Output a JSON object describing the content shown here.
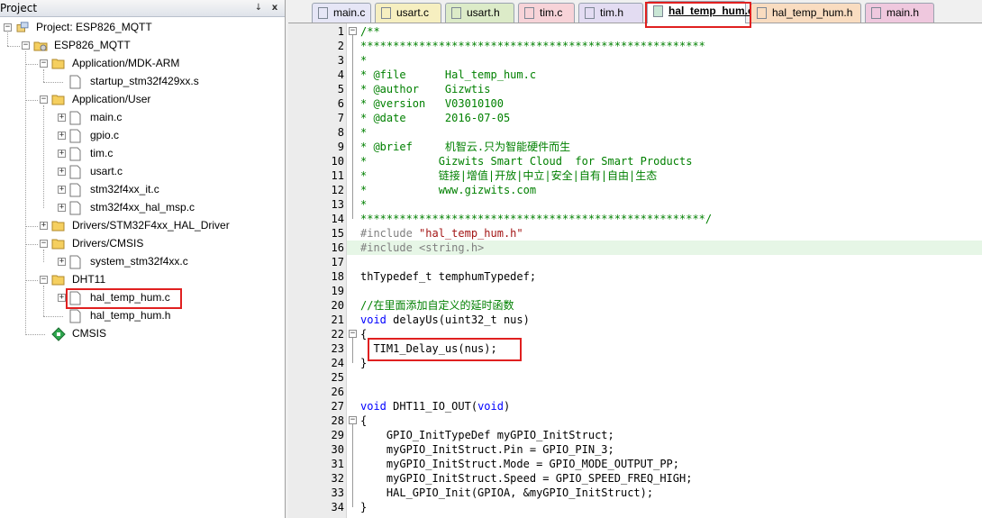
{
  "project_panel": {
    "title": "Project",
    "pin_glyph": "↓",
    "close_glyph": "x",
    "root": "Project: ESP826_MQTT",
    "target": "ESP826_MQTT",
    "groups": [
      {
        "name": "Application/MDK-ARM",
        "files": [
          "startup_stm32f429xx.s"
        ]
      },
      {
        "name": "Application/User",
        "files": [
          "main.c",
          "gpio.c",
          "tim.c",
          "usart.c",
          "stm32f4xx_it.c",
          "stm32f4xx_hal_msp.c"
        ]
      },
      {
        "name": "Drivers/STM32F4xx_HAL_Driver",
        "files": []
      },
      {
        "name": "Drivers/CMSIS",
        "files": [
          "system_stm32f4xx.c"
        ]
      },
      {
        "name": "DHT11",
        "files": [
          "hal_temp_hum.c",
          "hal_temp_hum.h"
        ]
      }
    ],
    "cmsis": "CMSIS"
  },
  "tabs": [
    {
      "label": "main.c",
      "color": "#e6e6f6"
    },
    {
      "label": "usart.c",
      "color": "#f6efc0"
    },
    {
      "label": "usart.h",
      "color": "#dcebc8"
    },
    {
      "label": "tim.c",
      "color": "#f7d3d8"
    },
    {
      "label": "tim.h",
      "color": "#e3dcf2"
    },
    {
      "label": "hal_temp_hum.c",
      "color": "#c9e6d5",
      "active": true
    },
    {
      "label": "hal_temp_hum.h",
      "color": "#f9dcc0"
    },
    {
      "label": "main.h",
      "color": "#efc8de"
    }
  ],
  "editor": {
    "lines": [
      {
        "n": "1",
        "segs": [
          [
            "c",
            "/**"
          ]
        ]
      },
      {
        "n": "2",
        "segs": [
          [
            "c",
            "*****************************************************"
          ]
        ]
      },
      {
        "n": "3",
        "segs": [
          [
            "c",
            "*"
          ]
        ]
      },
      {
        "n": "4",
        "segs": [
          [
            "c",
            "* @file      Hal_temp_hum.c"
          ]
        ]
      },
      {
        "n": "5",
        "segs": [
          [
            "c",
            "* @author    Gizwtis"
          ]
        ]
      },
      {
        "n": "6",
        "segs": [
          [
            "c",
            "* @version   V03010100"
          ]
        ]
      },
      {
        "n": "7",
        "segs": [
          [
            "c",
            "* @date      2016-07-05"
          ]
        ]
      },
      {
        "n": "8",
        "segs": [
          [
            "c",
            "*"
          ]
        ]
      },
      {
        "n": "9",
        "segs": [
          [
            "c",
            "* @brief     机智云.只为智能硬件而生"
          ]
        ]
      },
      {
        "n": "10",
        "segs": [
          [
            "c",
            "*           Gizwits Smart Cloud  for Smart Products"
          ]
        ]
      },
      {
        "n": "11",
        "segs": [
          [
            "c",
            "*           链接|增值|开放|中立|安全|自有|自由|生态"
          ]
        ]
      },
      {
        "n": "12",
        "segs": [
          [
            "c",
            "*           www.gizwits.com"
          ]
        ]
      },
      {
        "n": "13",
        "segs": [
          [
            "c",
            "*"
          ]
        ]
      },
      {
        "n": "14",
        "segs": [
          [
            "c",
            "*****************************************************/"
          ]
        ]
      },
      {
        "n": "15",
        "segs": [
          [
            "d",
            "#include "
          ],
          [
            "s",
            "\"hal_temp_hum.h\""
          ]
        ]
      },
      {
        "n": "16",
        "segs": [
          [
            "d",
            "#include <string.h>"
          ]
        ]
      },
      {
        "n": "17",
        "segs": []
      },
      {
        "n": "18",
        "segs": [
          [
            "p",
            "thTypedef_t temphumTypedef;"
          ]
        ]
      },
      {
        "n": "19",
        "segs": []
      },
      {
        "n": "20",
        "segs": [
          [
            "c",
            "//在里面添加自定义的延时函数"
          ]
        ]
      },
      {
        "n": "21",
        "segs": [
          [
            "k",
            "void"
          ],
          [
            "p",
            " delayUs(uint32_t nus)"
          ]
        ]
      },
      {
        "n": "22",
        "segs": [
          [
            "p",
            "{"
          ]
        ]
      },
      {
        "n": "23",
        "segs": [
          [
            "p",
            "  TIM1_Delay_us(nus);"
          ]
        ]
      },
      {
        "n": "24",
        "segs": [
          [
            "p",
            "}"
          ]
        ]
      },
      {
        "n": "25",
        "segs": []
      },
      {
        "n": "26",
        "segs": []
      },
      {
        "n": "27",
        "segs": [
          [
            "k",
            "void"
          ],
          [
            "p",
            " DHT11_IO_OUT("
          ],
          [
            "k",
            "void"
          ],
          [
            "p",
            ")"
          ]
        ]
      },
      {
        "n": "28",
        "segs": [
          [
            "p",
            "{"
          ]
        ]
      },
      {
        "n": "29",
        "segs": [
          [
            "p",
            "    GPIO_InitTypeDef myGPIO_InitStruct;"
          ]
        ]
      },
      {
        "n": "30",
        "segs": [
          [
            "p",
            "    myGPIO_InitStruct.Pin = GPIO_PIN_3;"
          ]
        ]
      },
      {
        "n": "31",
        "segs": [
          [
            "p",
            "    myGPIO_InitStruct.Mode = GPIO_MODE_OUTPUT_PP;"
          ]
        ]
      },
      {
        "n": "32",
        "segs": [
          [
            "p",
            "    myGPIO_InitStruct.Speed = GPIO_SPEED_FREQ_HIGH;"
          ]
        ]
      },
      {
        "n": "33",
        "segs": [
          [
            "p",
            "    HAL_GPIO_Init(GPIOA, &myGPIO_InitStruct);"
          ]
        ]
      },
      {
        "n": "34",
        "segs": [
          [
            "p",
            "}"
          ]
        ]
      }
    ]
  },
  "colors": {
    "highlight": "#e02020",
    "current_line": "#e6f6e6"
  }
}
